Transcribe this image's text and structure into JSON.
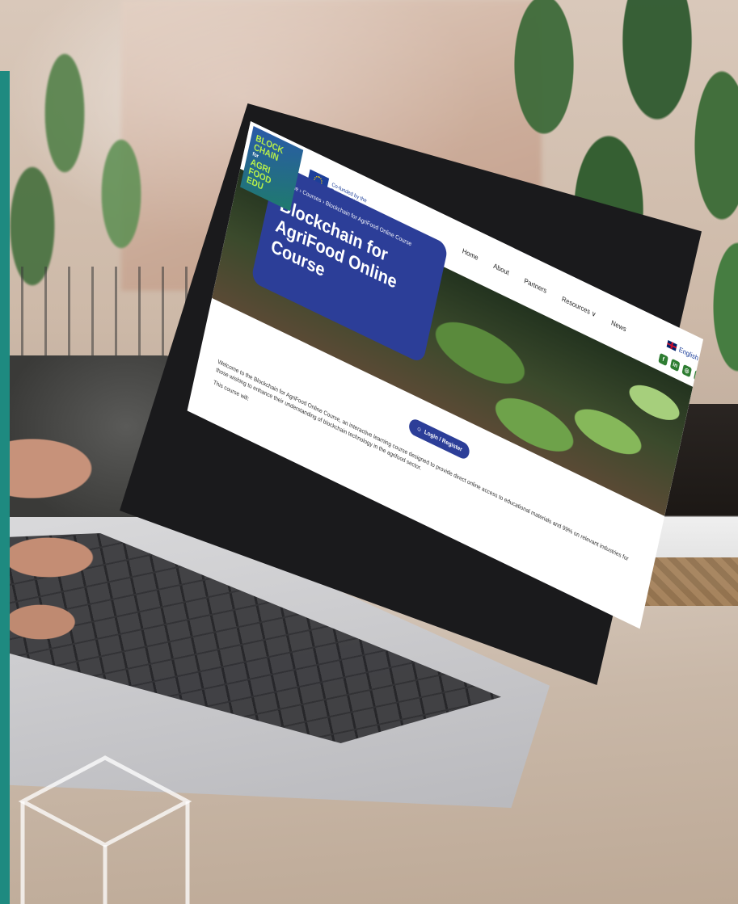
{
  "site": {
    "logo": [
      "BLOCK",
      "CHAIN",
      "for",
      "AGRI",
      "FOOD",
      "EDU"
    ],
    "eu_badge": "Co-funded by the European Union",
    "nav": [
      "Home",
      "About",
      "Partners",
      "Resources ∨",
      "News"
    ],
    "language": "English",
    "socials": [
      "f",
      "in",
      "◎",
      "▶"
    ]
  },
  "hero": {
    "breadcrumb": "Home › Courses › Blockchain for AgriFood Online Course",
    "title": "Blockchain for AgriFood Online Course"
  },
  "login_button": "Login / Register",
  "intro": {
    "paragraph": "Welcome to the Blockchain for AgriFood Online Course, an interactive learning course designed to provide direct online access to educational materials and 99% on relevant industries for those wishing to enhance their understanding of blockchain technology in the agrifood sector.",
    "course_tag": "This course will:"
  },
  "colors": {
    "brand_blue": "#2c3e98",
    "teal_accent": "#1e8a80",
    "logo_green": "#b8f04a"
  }
}
